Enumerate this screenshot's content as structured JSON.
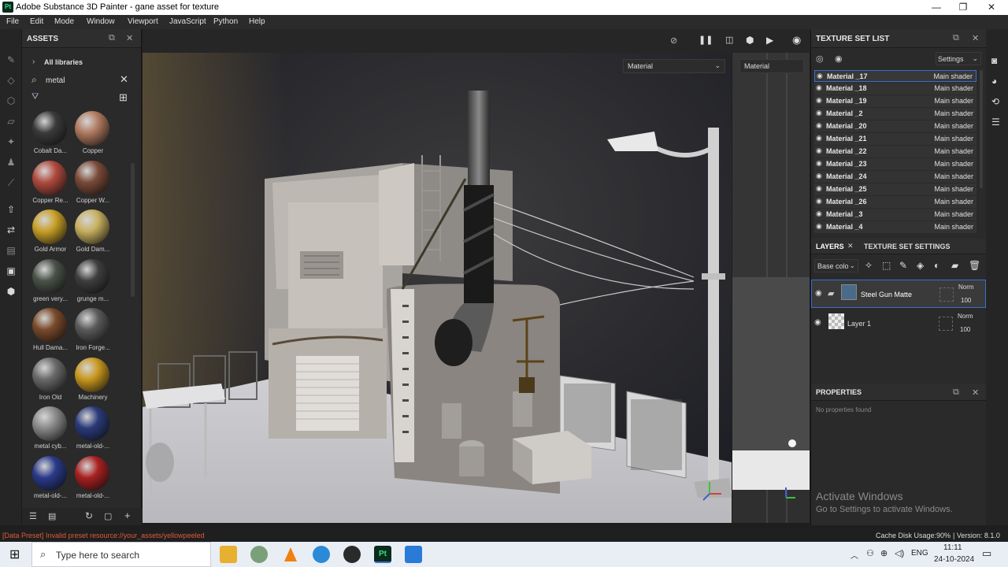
{
  "window": {
    "title": "Adobe Substance 3D Painter - gane asset for texture",
    "app_icon": "Pt"
  },
  "menu": [
    "File",
    "Edit",
    "Mode",
    "Window",
    "Viewport",
    "JavaScript",
    "Python",
    "Help"
  ],
  "assets": {
    "title": "ASSETS",
    "breadcrumb": "All libraries",
    "search_value": "metal",
    "items": [
      {
        "label": "Cobalt Da...",
        "color": "#3a3a3a"
      },
      {
        "label": "Copper",
        "color": "#b07a60"
      },
      {
        "label": "Copper Re...",
        "color": "#b04a3e"
      },
      {
        "label": "Copper W...",
        "color": "#7a4a38"
      },
      {
        "label": "Gold Armor",
        "color": "#c8a028"
      },
      {
        "label": "Gold Dam...",
        "color": "#c8b060"
      },
      {
        "label": "green very...",
        "color": "#4a5248"
      },
      {
        "label": "grunge m...",
        "color": "#3e3e3e"
      },
      {
        "label": "Hull Dama...",
        "color": "#7a4a2a"
      },
      {
        "label": "Iron Forge...",
        "color": "#5a5a5a"
      },
      {
        "label": "Iron Old",
        "color": "#6a6a6a"
      },
      {
        "label": "Machinery",
        "color": "#c8981e"
      },
      {
        "label": "metal cyb...",
        "color": "#8a8a8a"
      },
      {
        "label": "metal-old-...",
        "color": "#2a3a7a"
      },
      {
        "label": "metal-old-...",
        "color": "#2a3a8a"
      },
      {
        "label": "metal-old-...",
        "color": "#a82020"
      }
    ]
  },
  "viewport": {
    "material_dropdown": "Material",
    "uv_dropdown": "Material"
  },
  "texture_set_list": {
    "title": "TEXTURE SET LIST",
    "settings_label": "Settings",
    "rows": [
      {
        "name": "Material _17",
        "shader": "Main shader"
      },
      {
        "name": "Material _18",
        "shader": "Main shader"
      },
      {
        "name": "Material _19",
        "shader": "Main shader"
      },
      {
        "name": "Material _2",
        "shader": "Main shader"
      },
      {
        "name": "Material _20",
        "shader": "Main shader"
      },
      {
        "name": "Material _21",
        "shader": "Main shader"
      },
      {
        "name": "Material _22",
        "shader": "Main shader"
      },
      {
        "name": "Material _23",
        "shader": "Main shader"
      },
      {
        "name": "Material _24",
        "shader": "Main shader"
      },
      {
        "name": "Material _25",
        "shader": "Main shader"
      },
      {
        "name": "Material _26",
        "shader": "Main shader"
      },
      {
        "name": "Material _3",
        "shader": "Main shader"
      },
      {
        "name": "Material _4",
        "shader": "Main shader"
      }
    ]
  },
  "layers": {
    "tab_layers": "LAYERS",
    "tab_settings": "TEXTURE SET SETTINGS",
    "channel": "Base colo",
    "items": [
      {
        "name": "Steel Gun Matte",
        "blend": "Norm",
        "opacity": "100"
      },
      {
        "name": "Layer 1",
        "blend": "Norm",
        "opacity": "100"
      }
    ]
  },
  "properties": {
    "title": "PROPERTIES",
    "empty": "No properties found"
  },
  "watermark": {
    "line1": "Activate Windows",
    "line2": "Go to Settings to activate Windows."
  },
  "status": {
    "message": "[Data Preset] Invalid preset resource://your_assets/yellowpeeled",
    "cache": "Cache Disk Usage:",
    "cache_value": "90%",
    "version": "| Version: 8.1.0"
  },
  "taskbar": {
    "search_placeholder": "Type here to search",
    "time": "11:11",
    "date": "24-10-2024",
    "lang": "ENG"
  },
  "colors": {
    "status_error": "#e05a3a",
    "selection": "#3a6fd0"
  }
}
